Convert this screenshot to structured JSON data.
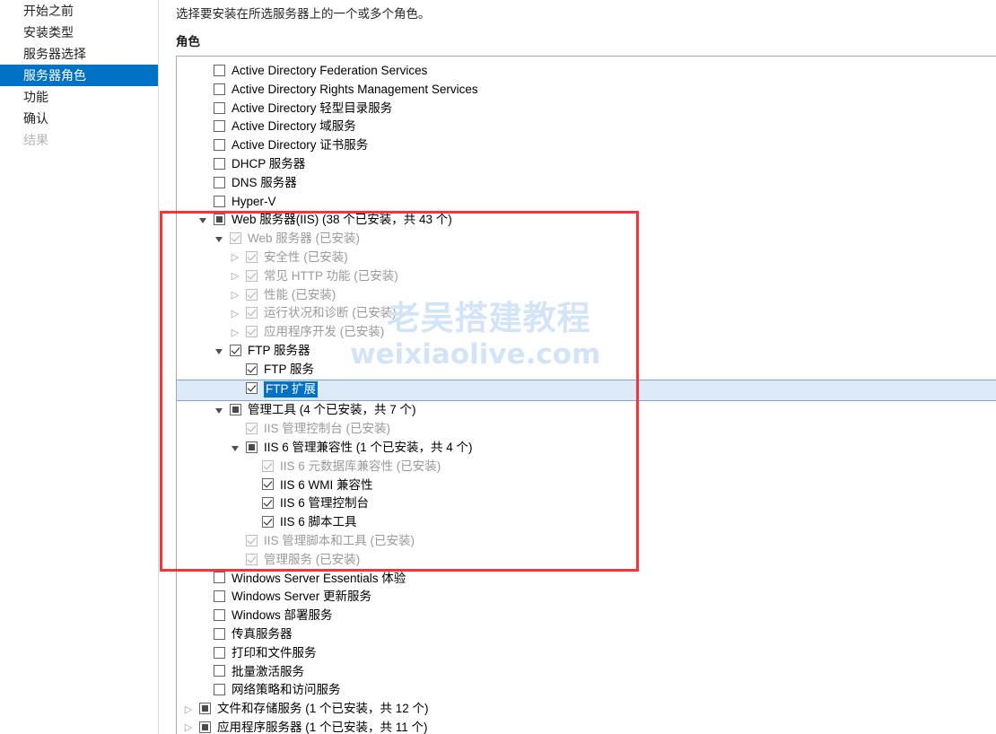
{
  "sidebar": {
    "items": [
      {
        "label": "开始之前",
        "state": "normal"
      },
      {
        "label": "安装类型",
        "state": "normal"
      },
      {
        "label": "服务器选择",
        "state": "normal"
      },
      {
        "label": "服务器角色",
        "state": "selected"
      },
      {
        "label": "功能",
        "state": "normal"
      },
      {
        "label": "确认",
        "state": "normal"
      },
      {
        "label": "结果",
        "state": "disabled"
      }
    ]
  },
  "content": {
    "intro_text": "选择要安装在所选服务器上的一个或多个角色。",
    "roles_label": "角色"
  },
  "roles": [
    {
      "label": "Active Directory Federation Services",
      "indent": 0,
      "twisty": "none",
      "check": "unchecked",
      "dim": false,
      "selected": false
    },
    {
      "label": "Active Directory Rights Management Services",
      "indent": 0,
      "twisty": "none",
      "check": "unchecked",
      "dim": false,
      "selected": false
    },
    {
      "label": "Active Directory 轻型目录服务",
      "indent": 0,
      "twisty": "none",
      "check": "unchecked",
      "dim": false,
      "selected": false
    },
    {
      "label": "Active Directory 域服务",
      "indent": 0,
      "twisty": "none",
      "check": "unchecked",
      "dim": false,
      "selected": false
    },
    {
      "label": "Active Directory 证书服务",
      "indent": 0,
      "twisty": "none",
      "check": "unchecked",
      "dim": false,
      "selected": false
    },
    {
      "label": "DHCP 服务器",
      "indent": 0,
      "twisty": "none",
      "check": "unchecked",
      "dim": false,
      "selected": false
    },
    {
      "label": "DNS 服务器",
      "indent": 0,
      "twisty": "none",
      "check": "unchecked",
      "dim": false,
      "selected": false
    },
    {
      "label": "Hyper-V",
      "indent": 0,
      "twisty": "none",
      "check": "unchecked",
      "dim": false,
      "selected": false
    },
    {
      "label": "Web 服务器(IIS) (38 个已安装，共 43 个)",
      "indent": 0,
      "twisty": "expanded",
      "check": "mixed",
      "dim": false,
      "selected": false
    },
    {
      "label": "Web 服务器 (已安装)",
      "indent": 1,
      "twisty": "expanded",
      "check": "checked",
      "dim": true,
      "selected": false
    },
    {
      "label": "安全性 (已安装)",
      "indent": 2,
      "twisty": "collapsed",
      "check": "checked",
      "dim": true,
      "selected": false
    },
    {
      "label": "常见 HTTP 功能 (已安装)",
      "indent": 2,
      "twisty": "collapsed",
      "check": "checked",
      "dim": true,
      "selected": false
    },
    {
      "label": "性能 (已安装)",
      "indent": 2,
      "twisty": "collapsed",
      "check": "checked",
      "dim": true,
      "selected": false
    },
    {
      "label": "运行状况和诊断 (已安装)",
      "indent": 2,
      "twisty": "collapsed",
      "check": "checked",
      "dim": true,
      "selected": false
    },
    {
      "label": "应用程序开发 (已安装)",
      "indent": 2,
      "twisty": "collapsed",
      "check": "checked",
      "dim": true,
      "selected": false
    },
    {
      "label": "FTP 服务器",
      "indent": 1,
      "twisty": "expanded",
      "check": "checked",
      "dim": false,
      "selected": false
    },
    {
      "label": "FTP 服务",
      "indent": 2,
      "twisty": "none",
      "check": "checked",
      "dim": false,
      "selected": false
    },
    {
      "label": "FTP 扩展",
      "indent": 2,
      "twisty": "none",
      "check": "checked",
      "dim": false,
      "selected": true
    },
    {
      "label": "管理工具 (4 个已安装，共 7 个)",
      "indent": 1,
      "twisty": "expanded",
      "check": "mixed",
      "dim": false,
      "selected": false
    },
    {
      "label": "IIS 管理控制台 (已安装)",
      "indent": 2,
      "twisty": "none",
      "check": "checked",
      "dim": true,
      "selected": false
    },
    {
      "label": "IIS 6 管理兼容性 (1 个已安装，共 4 个)",
      "indent": 2,
      "twisty": "expanded",
      "check": "mixed",
      "dim": false,
      "selected": false
    },
    {
      "label": "IIS 6 元数据库兼容性 (已安装)",
      "indent": 3,
      "twisty": "none",
      "check": "checked",
      "dim": true,
      "selected": false
    },
    {
      "label": "IIS 6 WMI 兼容性",
      "indent": 3,
      "twisty": "none",
      "check": "checked",
      "dim": false,
      "selected": false
    },
    {
      "label": "IIS 6 管理控制台",
      "indent": 3,
      "twisty": "none",
      "check": "checked",
      "dim": false,
      "selected": false
    },
    {
      "label": "IIS 6 脚本工具",
      "indent": 3,
      "twisty": "none",
      "check": "checked",
      "dim": false,
      "selected": false
    },
    {
      "label": "IIS 管理脚本和工具 (已安装)",
      "indent": 2,
      "twisty": "none",
      "check": "checked",
      "dim": true,
      "selected": false
    },
    {
      "label": "管理服务 (已安装)",
      "indent": 2,
      "twisty": "none",
      "check": "checked",
      "dim": true,
      "selected": false
    },
    {
      "label": "Windows Server Essentials 体验",
      "indent": 0,
      "twisty": "none",
      "check": "unchecked",
      "dim": false,
      "selected": false
    },
    {
      "label": "Windows Server 更新服务",
      "indent": 0,
      "twisty": "none",
      "check": "unchecked",
      "dim": false,
      "selected": false
    },
    {
      "label": "Windows 部署服务",
      "indent": 0,
      "twisty": "none",
      "check": "unchecked",
      "dim": false,
      "selected": false
    },
    {
      "label": "传真服务器",
      "indent": 0,
      "twisty": "none",
      "check": "unchecked",
      "dim": false,
      "selected": false
    },
    {
      "label": "打印和文件服务",
      "indent": 0,
      "twisty": "none",
      "check": "unchecked",
      "dim": false,
      "selected": false
    },
    {
      "label": "批量激活服务",
      "indent": 0,
      "twisty": "none",
      "check": "unchecked",
      "dim": false,
      "selected": false
    },
    {
      "label": "网络策略和访问服务",
      "indent": 0,
      "twisty": "none",
      "check": "unchecked",
      "dim": false,
      "selected": false
    },
    {
      "label": "文件和存储服务 (1 个已安装，共 12 个)",
      "indent": -1,
      "twisty": "collapsed",
      "check": "mixed",
      "dim": false,
      "selected": false
    },
    {
      "label": "应用程序服务器 (1 个已安装，共 11 个)",
      "indent": -1,
      "twisty": "collapsed",
      "check": "mixed",
      "dim": false,
      "selected": false
    }
  ],
  "watermark": {
    "line1": "老吴搭建教程",
    "line2": "weixiaolive.com",
    "color": "#d4e4f7"
  },
  "annotation": {
    "red_box_color": "#f9333a"
  }
}
